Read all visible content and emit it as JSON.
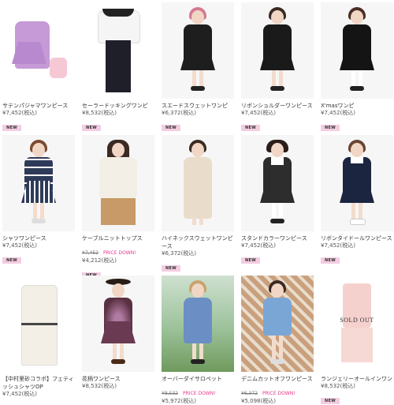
{
  "products": [
    {
      "name": "サテンパジャマワンピース",
      "price": "¥7,452(税込)",
      "badge": "NEW"
    },
    {
      "name": "セーラードッキングワンピ",
      "price": "¥8,532(税込)",
      "badge": "NEW"
    },
    {
      "name": "スエードスウェットワンピ",
      "price": "¥6,372(税込)",
      "badge": "NEW"
    },
    {
      "name": "リボンショルダーワンピース",
      "price": "¥7,452(税込)",
      "badge": "NEW"
    },
    {
      "name": "X'masワンピ",
      "price": "¥7,452(税込)",
      "badge": "NEW"
    },
    {
      "name": "シャツワンピース",
      "price": "¥7,452(税込)",
      "badge": "NEW"
    },
    {
      "name": "ケーブルニットトップス",
      "old_price": "¥7,452",
      "price_down": "PRICE DOWN!",
      "price": "¥4,212(税込)",
      "badge": "NEW"
    },
    {
      "name": "ハイネックスウェットワンピース",
      "price": "¥6,372(税込)",
      "badge": "NEW"
    },
    {
      "name": "スタンドカラーワンピース",
      "price": "¥7,452(税込)",
      "badge": "NEW"
    },
    {
      "name": "リボンタイドールワンピース",
      "price": "¥7,452(税込)",
      "badge": "NEW"
    },
    {
      "name": "【中村里砂コラボ】フェティッシュシャツOP",
      "price": "¥7,452(税込)"
    },
    {
      "name": "花柄ワンピース",
      "price": "¥8,532(税込)"
    },
    {
      "name": "オーバーダイサロペット",
      "old_price": "¥8,532",
      "price_down": "PRICE DOWN!",
      "price": "¥5,972(税込)"
    },
    {
      "name": "デニムカットオフワンピース",
      "old_price": "¥6,372",
      "price_down": "PRICE DOWN!",
      "price": "¥5,098(税込)"
    },
    {
      "name": "ランジェリーオールインワン",
      "price": "¥8,532(税込)",
      "badge": "NEW",
      "overlay": "SOLD OUT"
    }
  ]
}
